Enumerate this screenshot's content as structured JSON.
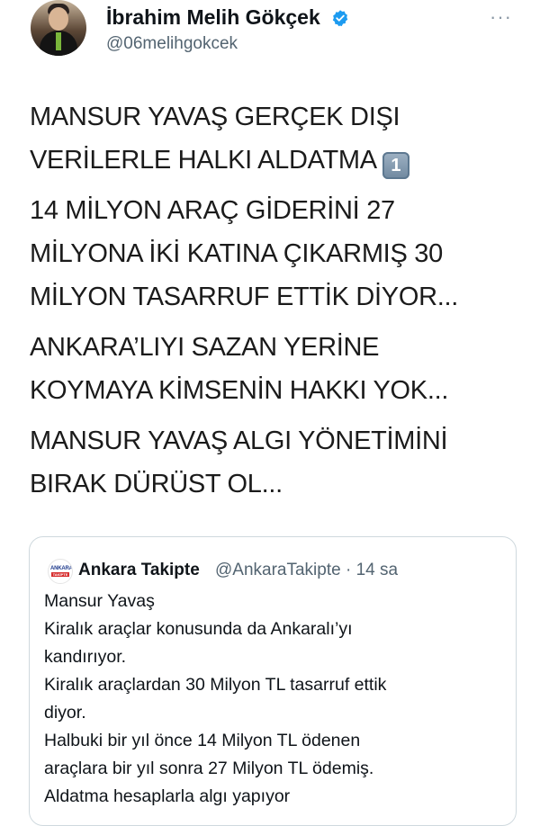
{
  "author": {
    "display_name": "İbrahim Melih Gökçek",
    "handle": "@06melihgokcek",
    "verified": true,
    "more_icon": "ellipsis-icon"
  },
  "tweet": {
    "paragraphs": [
      {
        "lines": [
          "MANSUR YAVAŞ GERÇEK DIŞI",
          "VERİLERLE HALKI ALDATMA"
        ],
        "emoji": "1"
      },
      {
        "lines": [
          "14 MİLYON ARAÇ GİDERİNİ 27",
          "MİLYONA İKİ KATINA ÇIKARMIŞ 30",
          "MİLYON TASARRUF ETTİK DİYOR..."
        ]
      },
      {
        "lines": [
          "ANKARA’LIYI SAZAN YERİNE",
          "KOYMAYA KİMSENİN HAKKI YOK..."
        ]
      },
      {
        "lines": [
          "MANSUR YAVAŞ ALGI YÖNETİMİNİ",
          "BIRAK DÜRÜST OL..."
        ]
      }
    ]
  },
  "quoted_tweet": {
    "avatar_text_top": "ANKARA",
    "avatar_text_bottom": "TAKİPTE",
    "display_name": "Ankara Takipte",
    "handle_and_time": "@AnkaraTakipte · 14 sa",
    "lines": [
      "Mansur Yavaş",
      "Kiralık araçlar konusunda da Ankaralı’yı",
      "kandırıyor.",
      "Kiralık araçlardan 30 Milyon TL tasarruf ettik",
      "diyor.",
      "Halbuki bir yıl önce 14 Milyon TL ödenen",
      "araçlara bir yıl sonra 27 Milyon TL ödemiş.",
      "Aldatma hesaplarla algı yapıyor"
    ]
  },
  "colors": {
    "verified_badge": "#1d9bf0",
    "secondary_text": "#536471",
    "border": "#cfd9de"
  }
}
